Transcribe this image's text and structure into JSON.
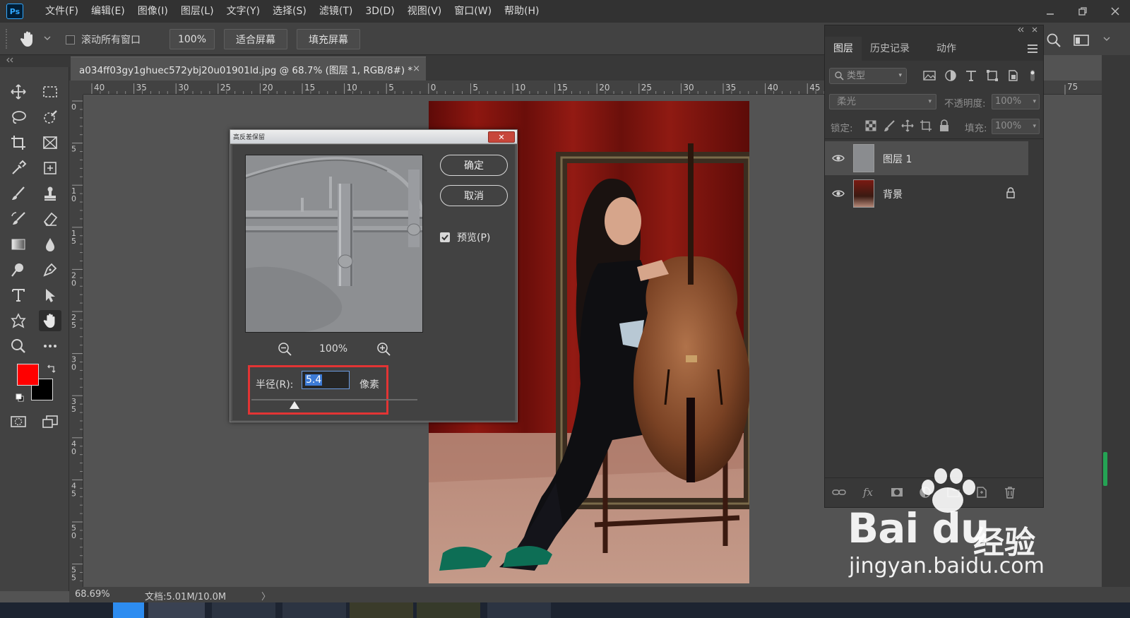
{
  "app": {
    "logo": "Ps",
    "menu": [
      "文件(F)",
      "编辑(E)",
      "图像(I)",
      "图层(L)",
      "文字(Y)",
      "选择(S)",
      "滤镜(T)",
      "3D(D)",
      "视图(V)",
      "窗口(W)",
      "帮助(H)"
    ],
    "window_controls": [
      "minimize-icon",
      "restore-icon",
      "close-icon"
    ]
  },
  "options_bar": {
    "tool_icon": "hand-icon",
    "scroll_all_label": "滚动所有窗口",
    "scroll_all_checked": false,
    "zoom_100_label": "100%",
    "fit_screen_label": "适合屏幕",
    "fill_screen_label": "填充屏幕"
  },
  "document": {
    "tab_title": "a034ff03gy1ghuec572ybj20u01901ld.jpg @ 68.7% (图层 1, RGB/8#) *",
    "close_label": "×"
  },
  "rulers": {
    "h_ticks": [
      "40",
      "35",
      "30",
      "25",
      "20",
      "15",
      "10",
      "5",
      "0",
      "5",
      "10",
      "15",
      "20",
      "25",
      "30",
      "35",
      "40",
      "45",
      "75"
    ],
    "v_ticks": [
      "0",
      "5",
      "1 0",
      "1 5",
      "2 0",
      "2 5",
      "3 0",
      "3 5",
      "4 0",
      "4 5",
      "5 0",
      "5 5"
    ]
  },
  "status": {
    "zoom": "68.69%",
    "doc_size": "文档:5.01M/10.0M",
    "arrow": "〉"
  },
  "colors": {
    "foreground": "#ff0000",
    "background": "#000000",
    "highlight_box": "#e23434"
  },
  "dialog": {
    "title": "高反差保留",
    "close_label": "✕",
    "ok_label": "确定",
    "cancel_label": "取消",
    "preview_label": "预览(P)",
    "preview_checked": true,
    "zoom_value": "100%",
    "radius_label": "半径(R):",
    "radius_value": "5.4",
    "radius_unit": "像素",
    "radius_slider_fraction": 0.26
  },
  "layers_panel": {
    "tabs": [
      "图层",
      "历史记录",
      "动作"
    ],
    "active_tab": "图层",
    "filter_placeholder": "类型",
    "blend_mode": "柔光",
    "opacity_label": "不透明度:",
    "opacity_value": "100%",
    "lock_label": "锁定:",
    "fill_label": "填充:",
    "fill_value": "100%",
    "layers": [
      {
        "name": "图层 1",
        "visible": true,
        "selected": true,
        "locked": false
      },
      {
        "name": "背景",
        "visible": true,
        "selected": false,
        "locked": true
      }
    ],
    "bottom_icons": [
      "link-icon",
      "fx-icon",
      "mask-icon",
      "adjustment-icon",
      "folder-icon",
      "new-layer-icon",
      "trash-icon"
    ]
  },
  "watermark": {
    "brand": "Bai du",
    "suffix": "经验",
    "url": "jingyan.baidu.com"
  }
}
